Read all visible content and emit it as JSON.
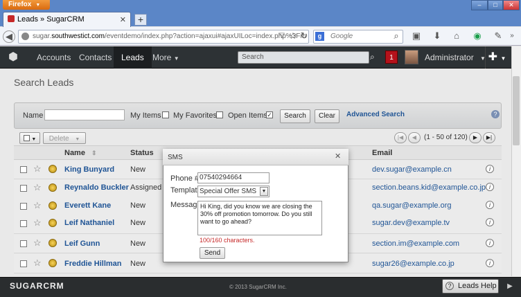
{
  "browser": {
    "menu_label": "Firefox",
    "tab_title": "Leads » SugarCRM",
    "url_prefix": "sugar.",
    "url_host": "southwestict.com",
    "url_path": "/eventdemo/index.php?action=ajaxui#ajaxUILoc=index.php%3Fm",
    "search_engine_placeholder": "Google"
  },
  "nav": {
    "items": [
      "Accounts",
      "Contacts",
      "Leads",
      "More"
    ],
    "search_placeholder": "Search",
    "notification_count": "1",
    "user": "Administrator"
  },
  "page": {
    "title": "Search Leads",
    "filter": {
      "name_label": "Name",
      "my_items": "My Items",
      "my_favorites": "My Favorites",
      "open_items": "Open Items",
      "search_button": "Search",
      "clear_button": "Clear",
      "advanced_search": "Advanced Search"
    },
    "actions": {
      "delete": "Delete"
    },
    "pager_text": "(1 - 50 of 120)",
    "columns": {
      "name": "Name",
      "status": "Status",
      "email": "Email"
    },
    "rows": [
      {
        "name": "King Bunyard",
        "status": "New",
        "email": "dev.sugar@example.cn"
      },
      {
        "name": "Reynaldo Buckler",
        "status": "Assigned",
        "email": "section.beans.kid@example.co.jp"
      },
      {
        "name": "Everett Kane",
        "status": "New",
        "email": "qa.sugar@example.org"
      },
      {
        "name": "Leif Nathaniel",
        "status": "New",
        "email": "sugar.dev@example.tv"
      },
      {
        "name": "Leif Gunn",
        "status": "New",
        "email": "section.im@example.com"
      },
      {
        "name": "Freddie Hillman",
        "status": "New",
        "email": "sugar26@example.co.jp"
      }
    ]
  },
  "modal": {
    "title": "SMS",
    "phone_label": "Phone #:",
    "phone_value": "07540294664",
    "template_label": "Template",
    "template_value": "Special Offer SMS",
    "message_label": "Message",
    "message_value": "Hi King, did you know we are closing the 30% off promotion tomorrow.  Do you still want to go ahead?",
    "char_count": "100/160 characters.",
    "send_button": "Send"
  },
  "footer": {
    "logo": "SUGARCRM",
    "copyright": "© 2013 SugarCRM Inc.",
    "help_button": "Leads Help"
  },
  "colors": {
    "link": "#1f5495",
    "header_bg": "#2d3235",
    "warning": "#c62828"
  }
}
